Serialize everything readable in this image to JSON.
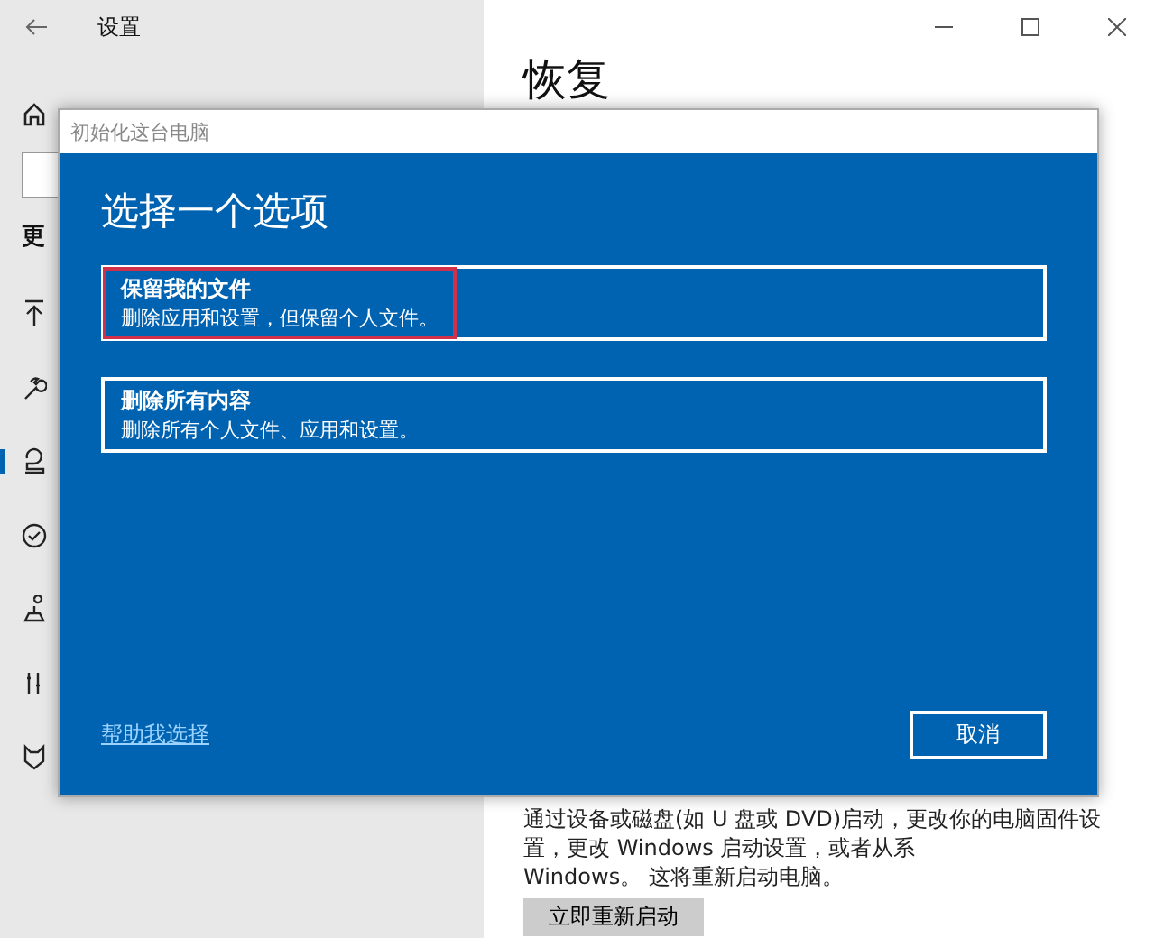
{
  "window": {
    "title": "设置"
  },
  "page": {
    "heading": "恢复",
    "section_heading": "更",
    "description_lines": [
      "通过设备或磁盘(如 U 盘或 DVD)启动，更改你的电脑固件设",
      "置，更改 Windows 启动设置，或者从系",
      "Windows。 这将重新启动电脑。"
    ],
    "restart_button": "立即重新启动"
  },
  "sidebar": {
    "items": [
      {
        "selected": false
      },
      {
        "selected": false
      },
      {
        "selected": true
      },
      {
        "selected": false
      },
      {
        "selected": false
      },
      {
        "selected": false
      },
      {
        "selected": false
      }
    ]
  },
  "dialog": {
    "title": "初始化这台电脑",
    "heading": "选择一个选项",
    "options": [
      {
        "title": "保留我的文件",
        "description": "删除应用和设置，但保留个人文件。",
        "highlighted": true
      },
      {
        "title": "删除所有内容",
        "description": "删除所有个人文件、应用和设置。",
        "highlighted": false
      }
    ],
    "help_link": "帮助我选择",
    "cancel_button": "取消"
  }
}
